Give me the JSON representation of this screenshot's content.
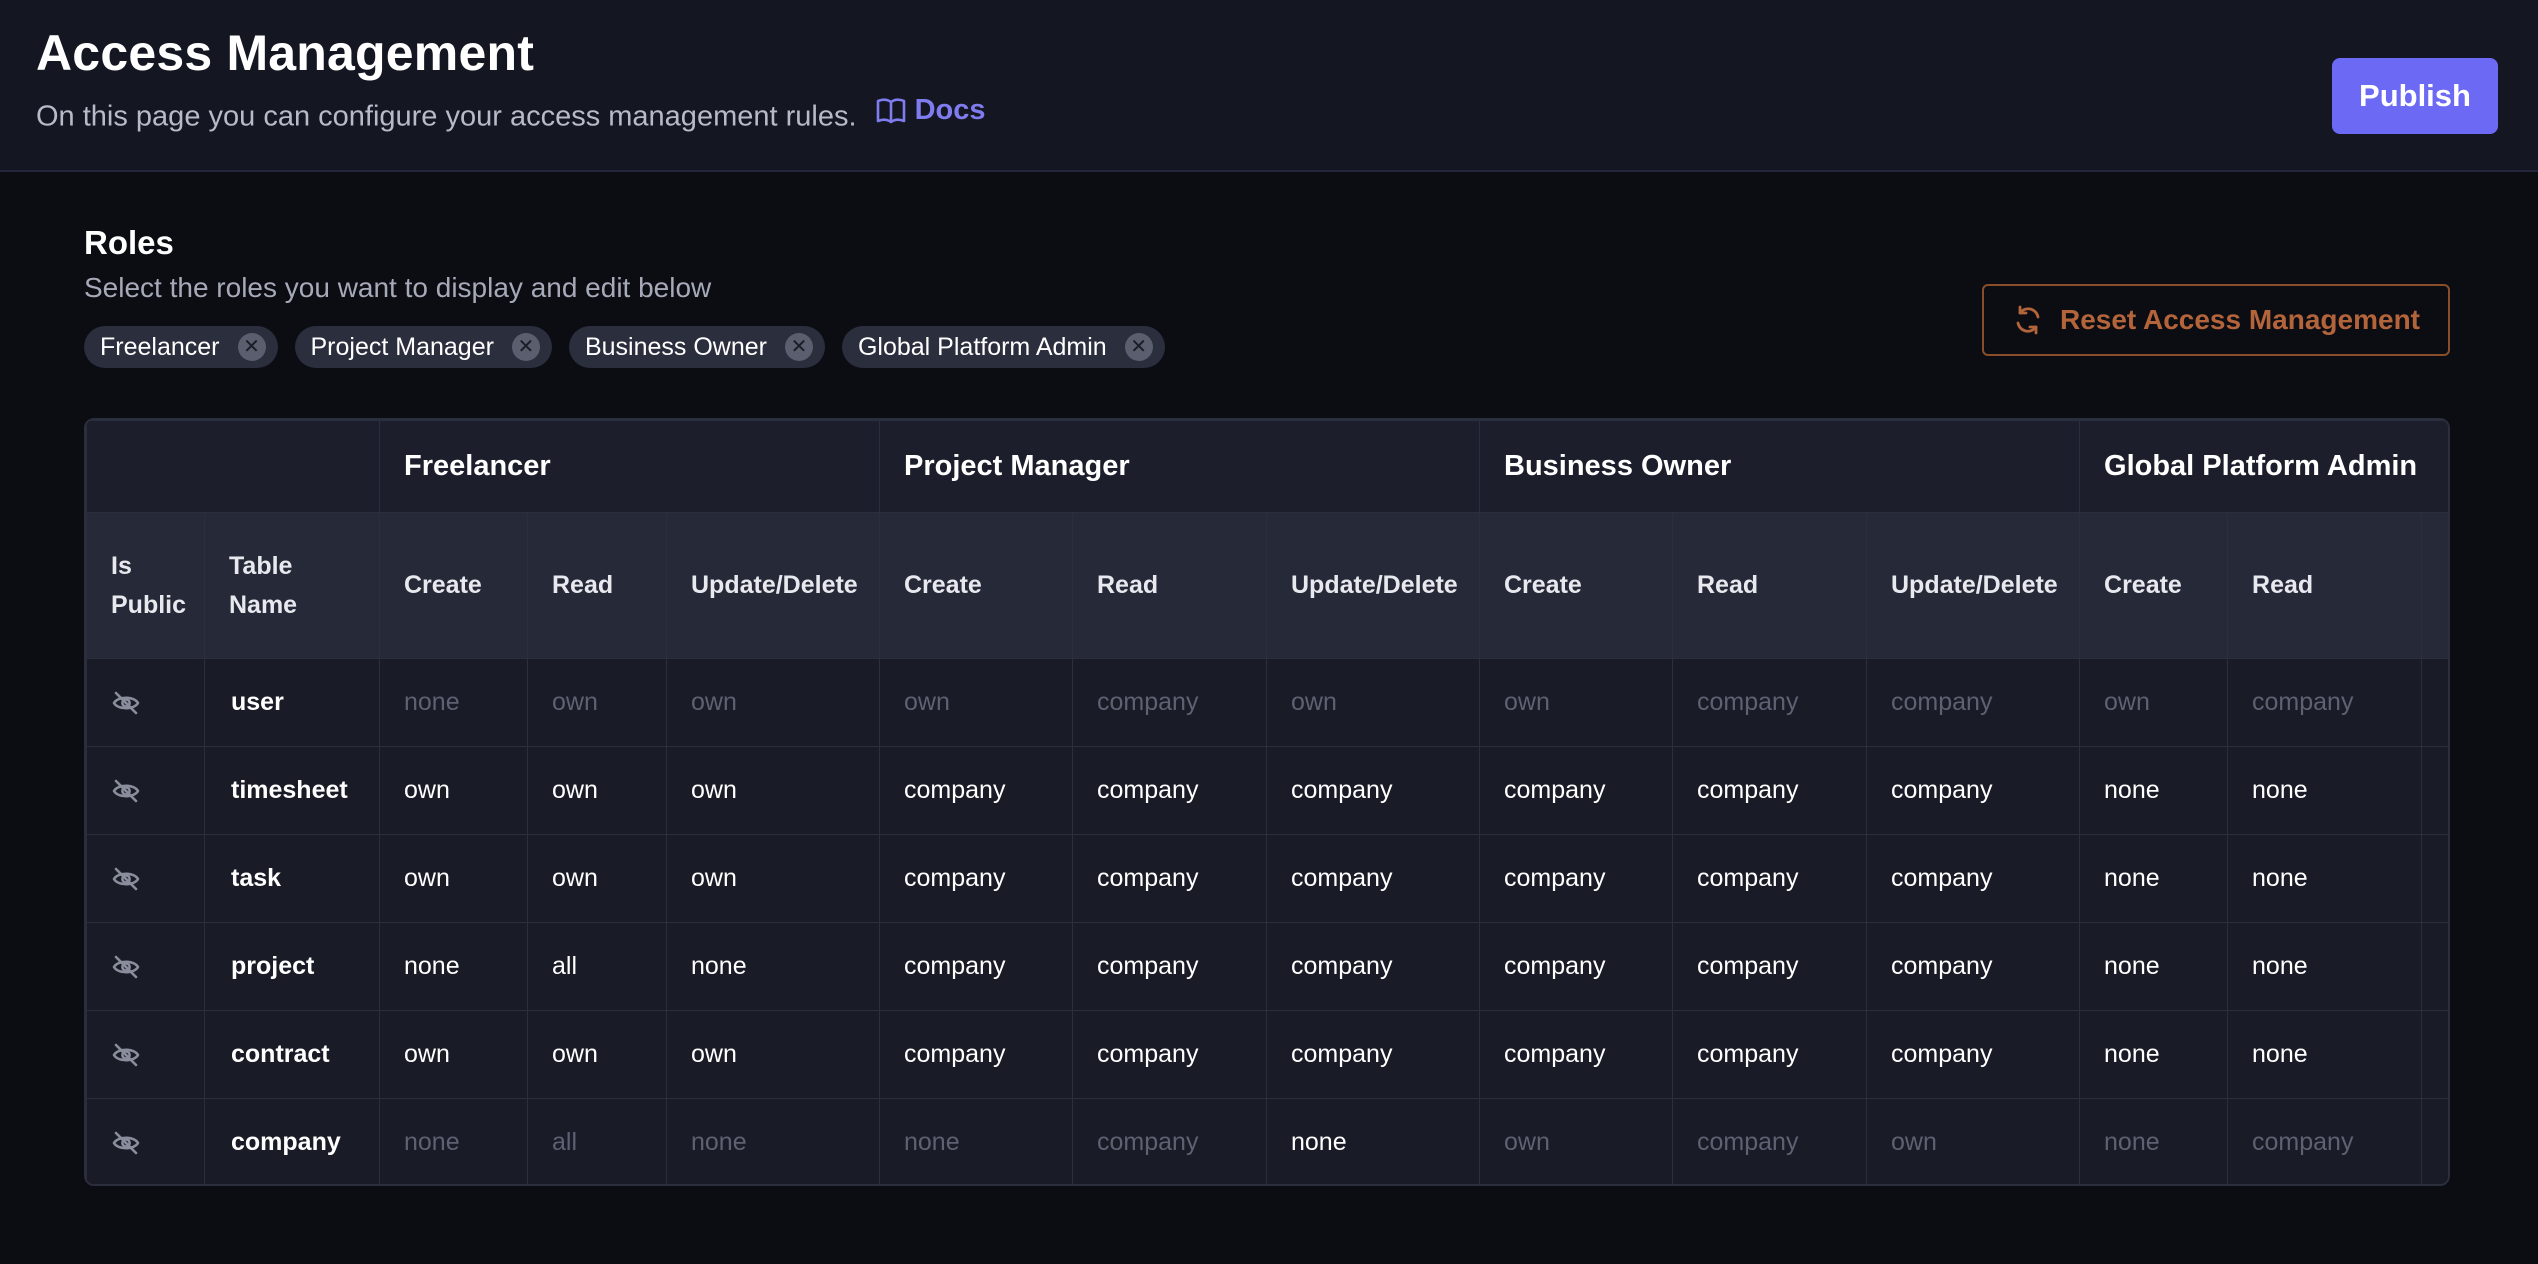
{
  "header": {
    "title": "Access Management",
    "subtitle": "On this page you can configure your access management rules.",
    "docs_label": "Docs",
    "publish_label": "Publish"
  },
  "roles": {
    "title": "Roles",
    "subtitle": "Select the roles you want to display and edit below",
    "chips": [
      "Freelancer",
      "Project Manager",
      "Business Owner",
      "Global Platform Admin"
    ],
    "reset_label": "Reset Access Management"
  },
  "table": {
    "col_is_public": "Is Public",
    "col_table_name": "Table Name",
    "role_groups": [
      "Freelancer",
      "Project Manager",
      "Business Owner",
      "Global Platform Admin"
    ],
    "permission_headers": [
      "Create",
      "Read",
      "Update/Delete",
      "Create",
      "Read",
      "Update/Delete",
      "Create",
      "Read",
      "Update/Delete",
      "Create",
      "Read"
    ],
    "rows": [
      {
        "name": "user",
        "values": [
          "none",
          "own",
          "own",
          "own",
          "company",
          "own",
          "own",
          "company",
          "company",
          "own",
          "company"
        ]
      },
      {
        "name": "timesheet",
        "values": [
          "own",
          "own",
          "own",
          "company",
          "company",
          "company",
          "company",
          "company",
          "company",
          "none",
          "none"
        ]
      },
      {
        "name": "task",
        "values": [
          "own",
          "own",
          "own",
          "company",
          "company",
          "company",
          "company",
          "company",
          "company",
          "none",
          "none"
        ]
      },
      {
        "name": "project",
        "values": [
          "none",
          "all",
          "none",
          "company",
          "company",
          "company",
          "company",
          "company",
          "company",
          "none",
          "none"
        ]
      },
      {
        "name": "contract",
        "values": [
          "own",
          "own",
          "own",
          "company",
          "company",
          "company",
          "company",
          "company",
          "company",
          "none",
          "none"
        ]
      },
      {
        "name": "company",
        "values": [
          "none",
          "all",
          "none",
          "none",
          "company",
          "none",
          "own",
          "company",
          "own",
          "none",
          "company"
        ]
      }
    ],
    "muted_cells": [
      [
        true,
        true,
        true,
        true,
        true,
        true,
        true,
        true,
        true,
        true,
        true
      ],
      [
        false,
        false,
        false,
        false,
        false,
        false,
        false,
        false,
        false,
        false,
        false
      ],
      [
        false,
        false,
        false,
        false,
        false,
        false,
        false,
        false,
        false,
        false,
        false
      ],
      [
        false,
        false,
        false,
        false,
        false,
        false,
        false,
        false,
        false,
        false,
        false
      ],
      [
        false,
        false,
        false,
        false,
        false,
        false,
        false,
        false,
        false,
        false,
        false
      ],
      [
        true,
        true,
        true,
        true,
        true,
        false,
        true,
        true,
        true,
        true,
        true
      ]
    ]
  },
  "colors": {
    "accent": "#6c6af5",
    "docs_link": "#7f7cf0",
    "reset": "#b4643a",
    "muted_text": "#5d6172"
  }
}
